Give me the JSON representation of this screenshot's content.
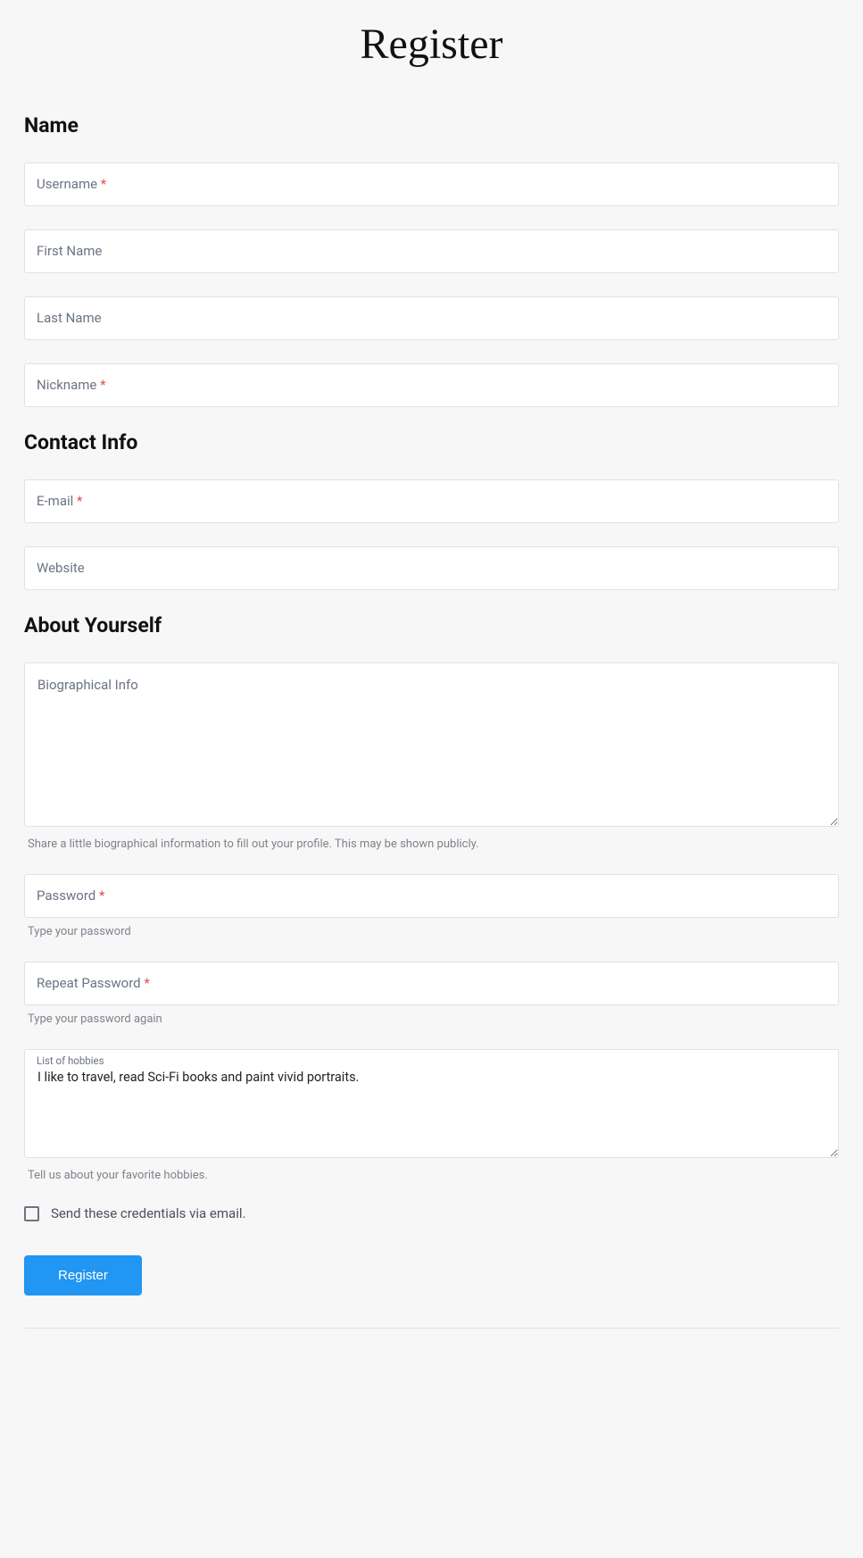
{
  "page": {
    "title": "Register"
  },
  "sections": {
    "name": "Name",
    "contact": "Contact Info",
    "about": "About Yourself"
  },
  "fields": {
    "username": {
      "label": "Username",
      "required": true,
      "value": ""
    },
    "first_name": {
      "label": "First Name",
      "required": false,
      "value": ""
    },
    "last_name": {
      "label": "Last Name",
      "required": false,
      "value": ""
    },
    "nickname": {
      "label": "Nickname",
      "required": true,
      "value": ""
    },
    "email": {
      "label": "E-mail",
      "required": true,
      "value": ""
    },
    "website": {
      "label": "Website",
      "required": false,
      "value": ""
    },
    "bio": {
      "label": "Biographical Info",
      "required": false,
      "value": "",
      "helper": "Share a little biographical information to fill out your profile. This may be shown publicly."
    },
    "password": {
      "label": "Password",
      "required": true,
      "value": "",
      "helper": "Type your password"
    },
    "repeat_password": {
      "label": "Repeat Password",
      "required": true,
      "value": "",
      "helper": "Type your password again"
    },
    "hobbies": {
      "label": "List of hobbies",
      "required": false,
      "value": "I like to travel, read Sci-Fi books and paint vivid portraits.",
      "helper": "Tell us about your favorite hobbies."
    }
  },
  "send_credentials": {
    "label": "Send these credentials via email.",
    "checked": false
  },
  "submit": {
    "label": "Register"
  },
  "required_marker": "*"
}
